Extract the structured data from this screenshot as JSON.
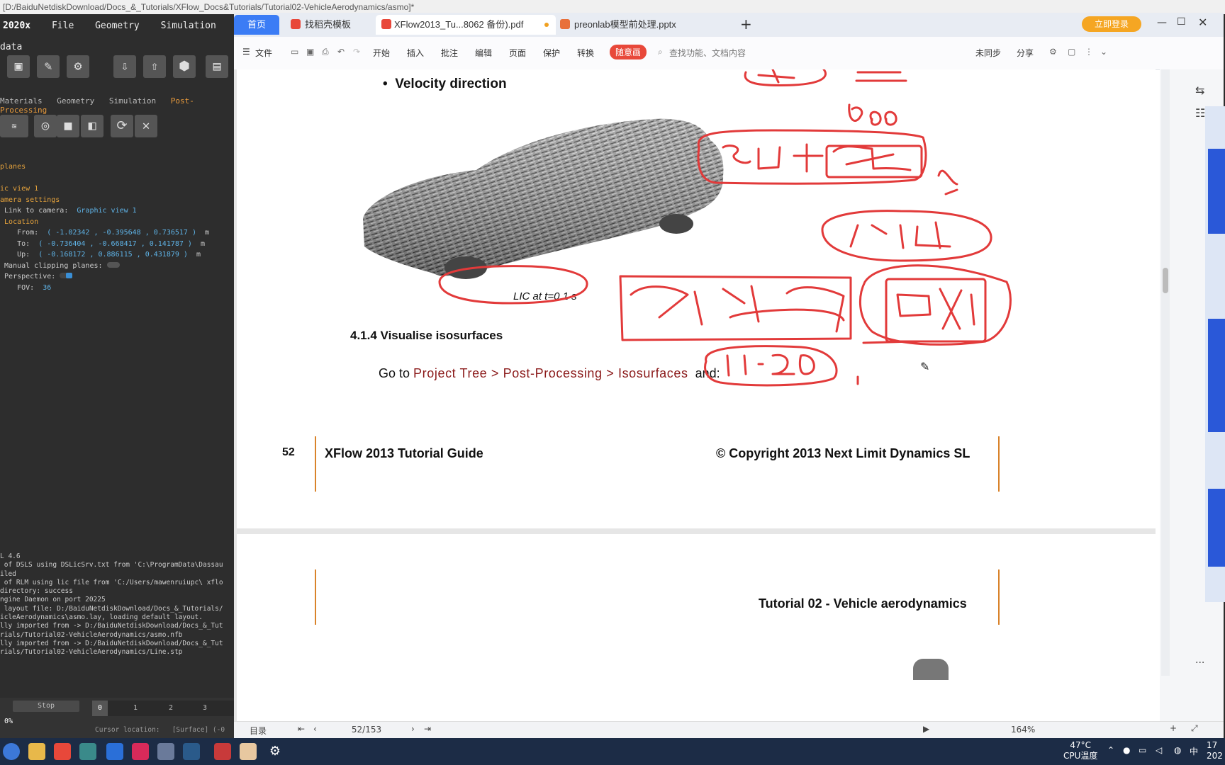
{
  "xflow": {
    "title": "[D:/BaiduNetdiskDownload/Docs_&_Tutorials/XFlow_Docs&Tutorials/Tutorial02-VehicleAerodynamics/asmo]*",
    "brand": "2020x",
    "menu": [
      "File",
      "Geometry",
      "Simulation data"
    ],
    "tabs": [
      "Materials",
      "Geometry",
      "Simulation",
      "Post-Processing"
    ],
    "tree": {
      "planes": "planes",
      "view": "ic view 1",
      "camera_settings": "amera settings",
      "link_label": "Link to camera:",
      "link_value": "Graphic view 1",
      "location": "Location",
      "from_label": "From:",
      "from_value": "( -1.02342 , -0.395648 , 0.736517 )",
      "to_label": "To:",
      "to_value": "( -0.736404 , -0.668417 , 0.141787 )",
      "up_label": "Up:",
      "up_value": "( -0.168172 , 0.886115 , 0.431879 )",
      "unit": "m",
      "clipping_label": "Manual clipping planes:",
      "perspective_label": "Perspective:",
      "fov_label": "FOV:",
      "fov_value": "36"
    },
    "log": [
      "L 4.6",
      " of DSLS using DSLicSrv.txt from 'C:\\ProgramData\\Dassau",
      "iled",
      " of RLM using lic file from 'C:/Users/mawenruiupc\\ xflo",
      "directory: success",
      "ngine Daemon on port 20225",
      " layout file: D:/BaiduNetdiskDownload/Docs_&_Tutorials/",
      "icleAerodynamics\\asmo.lay, loading default layout.",
      "lly imported from -> D:/BaiduNetdiskDownload/Docs_&_Tut",
      "rials/Tutorial02-VehicleAerodynamics/asmo.nfb",
      "lly imported from -> D:/BaiduNetdiskDownload/Docs_&_Tut",
      "rials/Tutorial02-VehicleAerodynamics/Line.stp"
    ],
    "stop_label": "Stop",
    "progress": "0%",
    "timeline": [
      "0",
      "1",
      "2",
      "3"
    ],
    "cursor_label": "Cursor location:",
    "cursor_value": "[Surface] (-0"
  },
  "wps": {
    "tabs": [
      {
        "label": "首页"
      },
      {
        "label": "找稻壳模板"
      },
      {
        "label": "XFlow2013_Tu...8062 备份).pdf"
      },
      {
        "label": "preonlab模型前处理.pptx"
      }
    ],
    "login_button": "立即登录",
    "menu": [
      "文件",
      "开始",
      "插入",
      "批注",
      "编辑",
      "页面",
      "保护",
      "转换"
    ],
    "draw_button": "随意画",
    "search_placeholder": "查找功能、文档内容",
    "sync": "未同步",
    "share": "分享",
    "page_indicator": "52/153",
    "zoom": "164%",
    "status_left": "目录"
  },
  "document": {
    "bullet": "Velocity direction",
    "caption": "LIC at t=0.1 s",
    "section": "4.1.4 Visualise isosurfaces",
    "instruction_prefix": "Go to ",
    "instruction_path": "Project Tree > Post-Processing > Isosurfaces",
    "instruction_suffix": "  and:",
    "footer_page": "52",
    "footer_title": "XFlow 2013  Tutorial Guide",
    "footer_copyright": "© Copyright 2013 Next Limit Dynamics SL",
    "header_next": "Tutorial 02 - Vehicle aerodynamics"
  },
  "taskbar": {
    "temp": "47°C",
    "temp_label": "CPU温度",
    "ime": "中",
    "clock_top": "17",
    "clock_bottom": "202"
  },
  "colors": {
    "wps_accent": "#3b7cf5",
    "ink": "#e23a3a",
    "path_text": "#8b1a1a",
    "footer_rule": "#d9832a"
  }
}
